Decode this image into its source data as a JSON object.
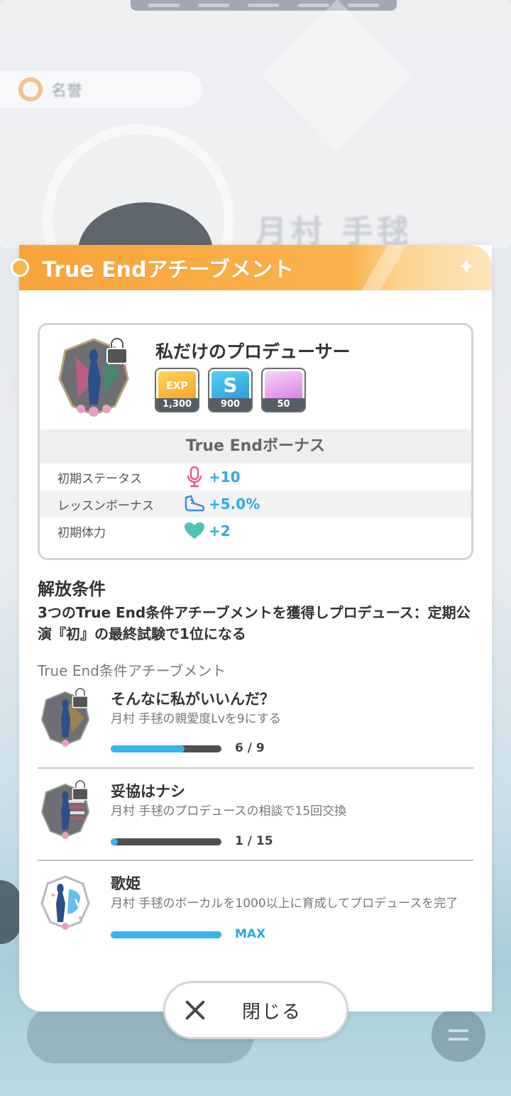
{
  "background": {
    "pill_text": "名誉",
    "name_text": "月村 手毬"
  },
  "modal": {
    "title": "True Endアチーブメント",
    "achievement": {
      "title": "私だけのプロデューサー",
      "rewards": [
        {
          "icon": "exp-icon",
          "mark": "EXP",
          "count": "1,300"
        },
        {
          "icon": "s-coin-icon",
          "mark": "S",
          "count": "900"
        },
        {
          "icon": "gem-icon",
          "mark": "",
          "count": "50"
        }
      ],
      "bonus_header": "True Endボーナス",
      "bonuses": [
        {
          "label": "初期ステータス",
          "icon": "microphone-icon",
          "value": "+10"
        },
        {
          "label": "レッスンボーナス",
          "icon": "dance-shoe-icon",
          "value": "+5.0%"
        },
        {
          "label": "初期体力",
          "icon": "heart-icon",
          "value": "+2"
        }
      ]
    },
    "condition_title": "解放条件",
    "condition_text": "3つのTrue End条件アチーブメントを獲得しプロデュース：定期公演『初』の最終試験で1位になる",
    "sub_title": "True End条件アチーブメント",
    "conditions": [
      {
        "title": "そんなに私がいいんだ？",
        "desc": "月村 手毬の親愛度Lvを9にする",
        "progress_text": "6 / 9",
        "progress": 0.667,
        "locked": true
      },
      {
        "title": "妥協はナシ",
        "desc": "月村 手毬のプロデュースの相談で15回交換",
        "progress_text": "1 / 15",
        "progress": 0.067,
        "locked": true
      },
      {
        "title": "歌姫",
        "desc": "月村 手毬のボーカルを1000以上に育成してプロデュースを完了",
        "progress_text": "MAX",
        "progress": 1.0,
        "locked": false
      }
    ]
  },
  "close_button": {
    "label": "閉じる"
  },
  "colors": {
    "header_orange": "#f8a43a",
    "accent_blue": "#2fa9e8",
    "progress_blue": "#3ab4f0"
  }
}
